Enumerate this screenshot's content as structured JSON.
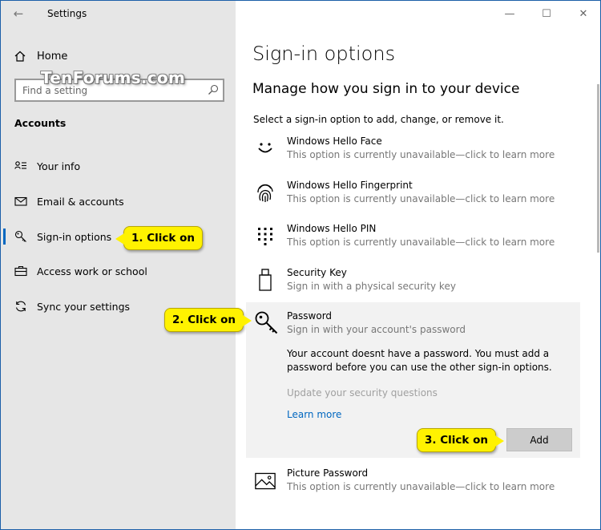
{
  "window": {
    "app_title": "Settings",
    "minimize": "—",
    "maximize": "☐",
    "close": "✕"
  },
  "watermark": "TenForums.com",
  "sidebar": {
    "home_label": "Home",
    "search_placeholder": "Find a setting",
    "section_title": "Accounts",
    "items": [
      {
        "label": "Your info",
        "icon": "contact-card-icon"
      },
      {
        "label": "Email & accounts",
        "icon": "mail-icon"
      },
      {
        "label": "Sign-in options",
        "icon": "key-icon",
        "active": true
      },
      {
        "label": "Access work or school",
        "icon": "briefcase-icon"
      },
      {
        "label": "Sync your settings",
        "icon": "sync-icon"
      }
    ]
  },
  "main": {
    "page_title": "Sign-in options",
    "sub_title": "Manage how you sign in to your device",
    "description": "Select a sign-in option to add, change, or remove it.",
    "options": [
      {
        "name": "Windows Hello Face",
        "subtitle": "This option is currently unavailable—click to learn more",
        "icon": "face-icon"
      },
      {
        "name": "Windows Hello Fingerprint",
        "subtitle": "This option is currently unavailable—click to learn more",
        "icon": "fingerprint-icon"
      },
      {
        "name": "Windows Hello PIN",
        "subtitle": "This option is currently unavailable—click to learn more",
        "icon": "pin-keypad-icon"
      },
      {
        "name": "Security Key",
        "subtitle": "Sign in with a physical security key",
        "icon": "usb-key-icon"
      }
    ],
    "password": {
      "name": "Password",
      "subtitle": "Sign in with your account's password",
      "message": "Your account doesnt have a password. You must add a password before you can use the other sign-in options.",
      "security_questions": "Update your security questions",
      "learn_more": "Learn more",
      "add_button": "Add",
      "icon": "key-icon"
    },
    "picture_password": {
      "name": "Picture Password",
      "subtitle": "This option is currently unavailable—click to learn more",
      "icon": "picture-icon"
    }
  },
  "callouts": {
    "step1": "1. Click on",
    "step2": "2. Click on",
    "step3": "3. Click on"
  },
  "colors": {
    "callout": "#fff200",
    "accent": "#0067c0",
    "sidebar_bg": "#e6e6e6"
  }
}
